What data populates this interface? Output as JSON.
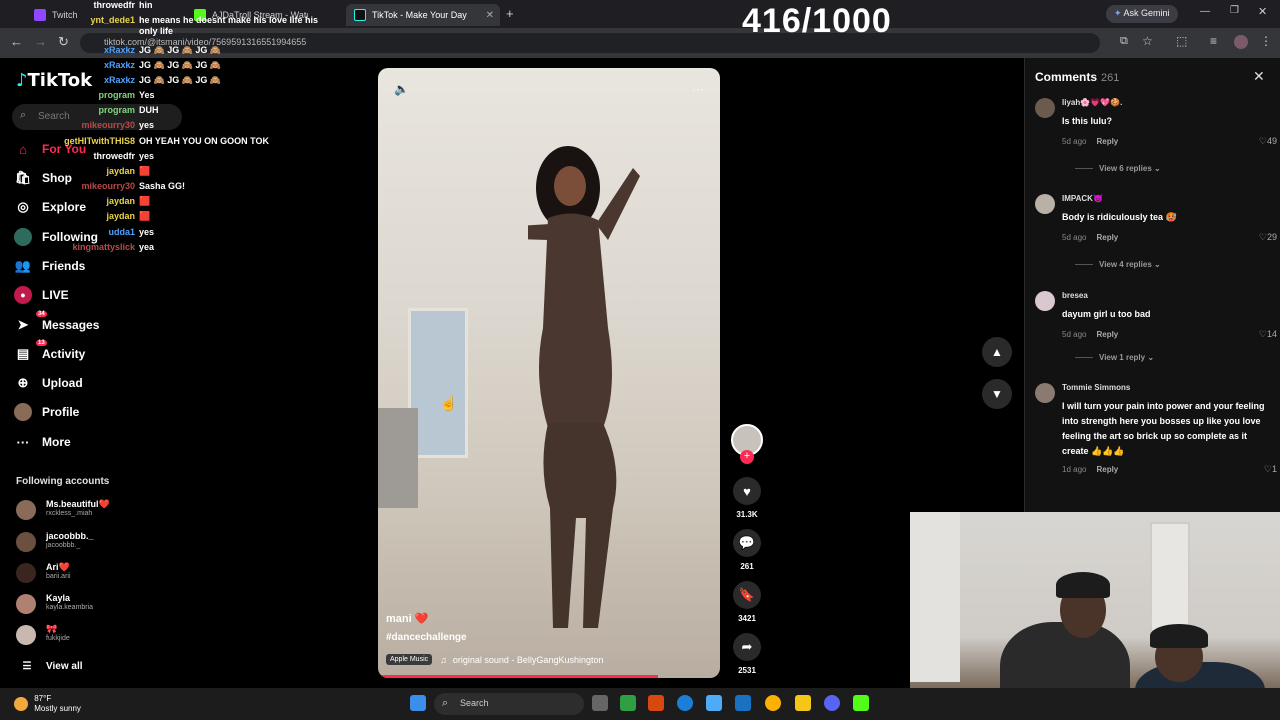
{
  "browser": {
    "tabs": [
      {
        "label": "Twitch"
      },
      {
        "label": "AJDaTroll Stream - Watch Live"
      },
      {
        "label": "TikTok - Make Your Day"
      }
    ],
    "url": "tiktok.com/@itsmani/video/7569591316551994655",
    "ask_gemini": "Ask Gemini"
  },
  "counter": "416/1000",
  "sidebar": {
    "logo": "TikTok",
    "search_placeholder": "Search",
    "nav": [
      {
        "label": "For You",
        "icon": "home-icon"
      },
      {
        "label": "Shop",
        "icon": "shop-icon"
      },
      {
        "label": "Explore",
        "icon": "compass-icon"
      },
      {
        "label": "Following",
        "icon": "avatar-icon"
      },
      {
        "label": "Friends",
        "icon": "friends-icon"
      },
      {
        "label": "LIVE",
        "icon": "live-icon"
      },
      {
        "label": "Messages",
        "icon": "messages-icon",
        "badge": "34"
      },
      {
        "label": "Activity",
        "icon": "activity-icon",
        "badge": "13"
      },
      {
        "label": "Upload",
        "icon": "upload-icon"
      },
      {
        "label": "Profile",
        "icon": "profile-icon"
      },
      {
        "label": "More",
        "icon": "more-icon"
      }
    ],
    "following_title": "Following accounts",
    "following": [
      {
        "name": "Ms.beautiful❤️",
        "handle": "rxckless_.miah"
      },
      {
        "name": "jacoobbb._",
        "handle": "jacoobbb._"
      },
      {
        "name": "Ari❤️",
        "handle": "barii.arii"
      },
      {
        "name": "Kayla",
        "handle": "kayla.keambria"
      },
      {
        "name": "🎀",
        "handle": "fukkjide"
      }
    ],
    "view_all": "View all"
  },
  "chat": [
    {
      "user": "throwedfr",
      "msg": "hin",
      "color": "#ffffff"
    },
    {
      "user": "ynt_dede1",
      "msg": "he means he doesnt make his love life his only life",
      "color": "#e8d44d"
    },
    {
      "user": "xRaxkz",
      "msg": "JG 🙈 JG 🙈 JG 🙈",
      "color": "#4fa3ff"
    },
    {
      "user": "xRaxkz",
      "msg": "JG 🙈 JG 🙈 JG 🙈",
      "color": "#4fa3ff"
    },
    {
      "user": "xRaxkz",
      "msg": "JG 🙈 JG 🙈 JG 🙈",
      "color": "#4fa3ff"
    },
    {
      "user": "program",
      "msg": "Yes",
      "color": "#7fd67f"
    },
    {
      "user": "program",
      "msg": "DUH",
      "color": "#7fd67f"
    },
    {
      "user": "mikeourry30",
      "msg": "yes",
      "color": "#b84a4a"
    },
    {
      "user": "getHITwithTHIS8",
      "msg": "OH YEAH YOU ON GOON TOK",
      "color": "#e8d44d"
    },
    {
      "user": "throwedfr",
      "msg": "yes",
      "color": "#ffffff"
    },
    {
      "user": "jaydan",
      "msg": "🟥",
      "color": "#e8d44d"
    },
    {
      "user": "mikeourry30",
      "msg": "Sasha GG!",
      "color": "#b84a4a"
    },
    {
      "user": "jaydan",
      "msg": "🟥",
      "color": "#e8d44d"
    },
    {
      "user": "jaydan",
      "msg": "🟥",
      "color": "#e8d44d"
    },
    {
      "user": "udda1",
      "msg": "yes",
      "color": "#4fa3ff"
    },
    {
      "user": "kingmattyslick",
      "msg": "yea",
      "color": "#b84a4a"
    }
  ],
  "video": {
    "author": "mani ❤️",
    "hashtag": "#dancechallenge",
    "music_badge": "Apple Music",
    "sound": "original sound - BellyGangKushington",
    "progress": 0.82
  },
  "actions": {
    "likes": "31.3K",
    "comments": "261",
    "saves": "3421",
    "shares": "2531"
  },
  "comments": {
    "title": "Comments",
    "count": "261",
    "items": [
      {
        "user": "liyah🌸💗💖🍪.",
        "text": "Is this lulu?",
        "age": "5d ago",
        "reply": "Reply",
        "likes": "49",
        "replies": "View 6 replies"
      },
      {
        "user": "IMPACK😈",
        "text": "Body is ridiculously tea 🥵",
        "age": "5d ago",
        "reply": "Reply",
        "likes": "29",
        "replies": "View 4 replies"
      },
      {
        "user": "bresea",
        "text": "dayum girl u too bad",
        "age": "5d ago",
        "reply": "Reply",
        "likes": "14",
        "replies": "View 1 reply"
      },
      {
        "user": "Tommie Simmons",
        "text": "I will turn your pain into power and your feeling into strength here you bosses up like you love feeling the art so brick up so complete as it create 👍👍👍",
        "age": "1d ago",
        "reply": "Reply",
        "likes": "1",
        "replies": ""
      }
    ]
  },
  "taskbar": {
    "temp": "87°F",
    "weather": "Mostly sunny",
    "search": "Search"
  }
}
